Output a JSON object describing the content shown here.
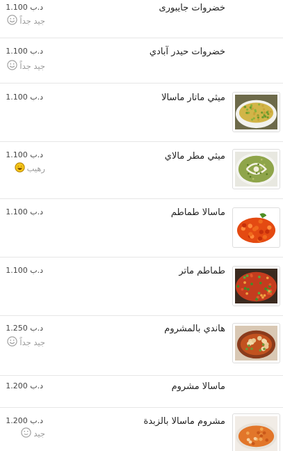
{
  "currency": "د.ب",
  "items": [
    {
      "name": "خضروات جايبورى",
      "price": "1.100",
      "rating": "جيد جداً",
      "rating_face": "smile",
      "has_image": false
    },
    {
      "name": "خضروات حيدر آبادي",
      "price": "1.100",
      "rating": "جيد جداً",
      "rating_face": "smile",
      "has_image": false
    },
    {
      "name": "ميثي ماتار ماسالا",
      "price": "1.100",
      "rating": "",
      "has_image": true,
      "image_icon": "peas-curry-photo"
    },
    {
      "name": "ميثي مطر مالاي",
      "price": "1.100",
      "rating": "رهيب",
      "rating_face": "laugh",
      "has_image": true,
      "image_icon": "green-curry-photo"
    },
    {
      "name": "ماسالا طماطم",
      "price": "1.100",
      "rating": "",
      "has_image": true,
      "image_icon": "tomato-masala-photo"
    },
    {
      "name": "طماطم ماتر",
      "price": "1.100",
      "rating": "",
      "has_image": true,
      "image_icon": "tomato-peas-photo"
    },
    {
      "name": "هاندي بالمشروم",
      "price": "1.250",
      "rating": "جيد جداً",
      "rating_face": "smile",
      "has_image": true,
      "image_icon": "mushroom-handi-photo"
    },
    {
      "name": "ماسالا مشروم",
      "price": "1.200",
      "rating": "",
      "has_image": false
    },
    {
      "name": "مشروم ماسالا بالزبدة",
      "price": "1.200",
      "rating": "جيد",
      "rating_face": "neutral-smile",
      "has_image": true,
      "image_icon": "butter-mushroom-photo"
    }
  ],
  "colors": {
    "divider": "#e6e6e6",
    "rating_text": "#9a9a9a",
    "laugh_face": "#f5c518"
  }
}
